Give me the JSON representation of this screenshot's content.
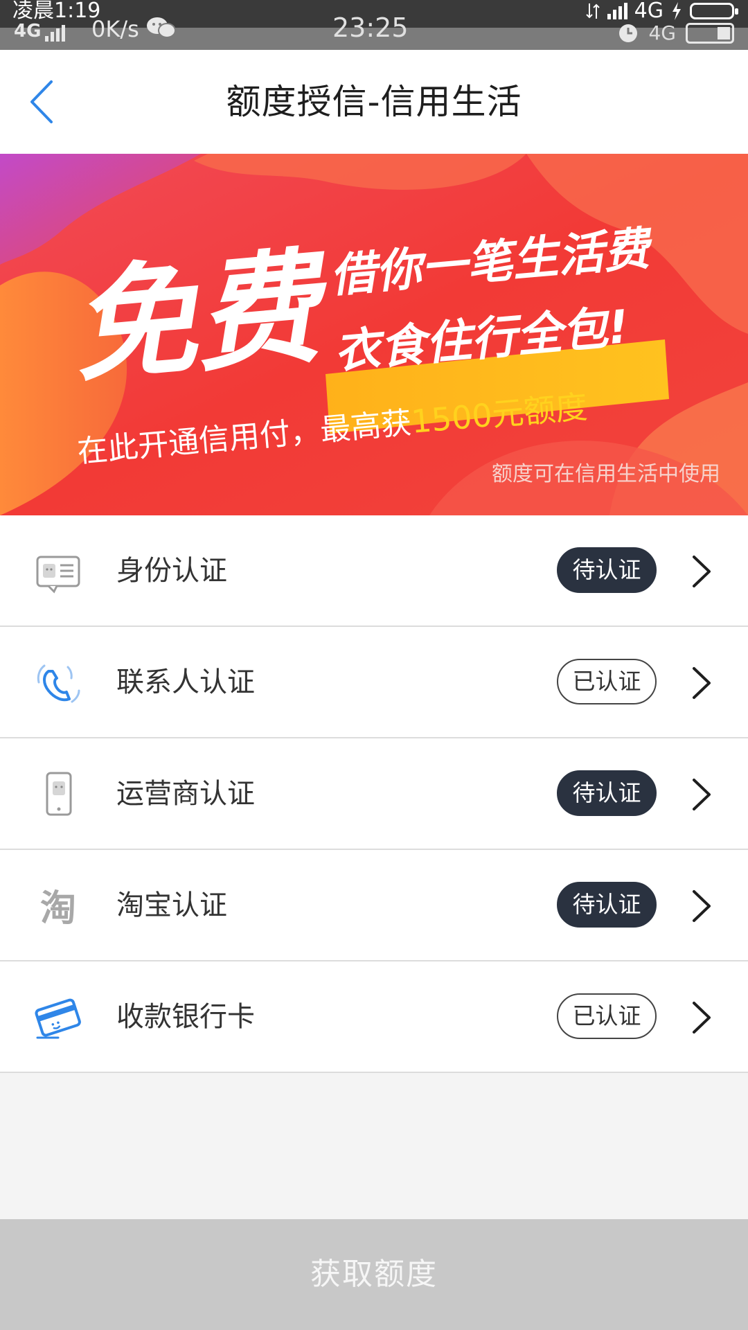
{
  "status_bar": {
    "top_time": "凌晨1:19",
    "network_left": "4G",
    "speed": "0K/s",
    "clock": "23:25",
    "network_right_top": "4G",
    "network_right_bottom": "4G"
  },
  "nav": {
    "title": "额度授信-信用生活"
  },
  "banner": {
    "headline_big": "免费",
    "headline_line1": "借你一笔生活费",
    "headline_line2": "衣食住行全包!",
    "subline_prefix": "在此开通信用付，最高获",
    "subline_amount": "1500元额度",
    "footnote": "额度可在信用生活中使用"
  },
  "auth_items": [
    {
      "label": "身份认证",
      "status": "待认证",
      "state": "pending",
      "icon": "id-card-icon"
    },
    {
      "label": "联系人认证",
      "status": "已认证",
      "state": "done",
      "icon": "phone-contact-icon"
    },
    {
      "label": "运营商认证",
      "status": "待认证",
      "state": "pending",
      "icon": "mobile-carrier-icon"
    },
    {
      "label": "淘宝认证",
      "status": "待认证",
      "state": "pending",
      "icon": "taobao-icon"
    },
    {
      "label": "收款银行卡",
      "status": "已认证",
      "state": "done",
      "icon": "bank-card-icon"
    }
  ],
  "icon_glyphs": {
    "taobao": "淘"
  },
  "submit_label": "获取额度",
  "colors": {
    "accent_blue": "#2f86e8",
    "badge_pending_bg": "#2a3240",
    "banner_red": "#f03a3a",
    "banner_yellow": "#ffd21e",
    "submit_disabled": "#c8c8c8"
  }
}
